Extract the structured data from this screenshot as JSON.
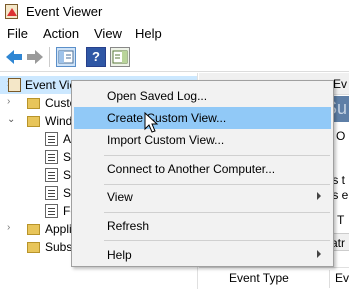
{
  "window": {
    "title": "Event Viewer"
  },
  "menu": [
    "File",
    "Action",
    "View",
    "Help"
  ],
  "toolbar": {
    "buttons": [
      "back-arrow-icon",
      "forward-arrow-icon",
      "show-hide-console-tree-icon",
      "help-icon",
      "show-hide-action-pane-icon"
    ],
    "help_glyph": "?"
  },
  "tree": {
    "items": [
      {
        "label": "Event Viewer (Local)",
        "shown": "Event Vie",
        "icon": "event-viewer-icon",
        "toggle": "›",
        "selected": true
      },
      {
        "label": "Custom Views",
        "shown": "Custo",
        "icon": "folder-icon",
        "toggle": "›"
      },
      {
        "label": "Windows Logs",
        "shown": "Wind",
        "icon": "folder-icon",
        "toggle": "⌄"
      },
      {
        "label": "Application",
        "shown": "A",
        "icon": "log-icon"
      },
      {
        "label": "Security",
        "shown": "Se",
        "icon": "log-icon"
      },
      {
        "label": "Setup",
        "shown": "Se",
        "icon": "log-icon"
      },
      {
        "label": "System",
        "shown": "Sy",
        "icon": "log-icon"
      },
      {
        "label": "Forwarded Events",
        "shown": "Fo",
        "icon": "log-icon"
      },
      {
        "label": "Applications and Services Logs",
        "shown": "Appli",
        "icon": "folder-icon",
        "toggle": "›"
      },
      {
        "label": "Subscriptions",
        "shown": "Subsc",
        "icon": "folder-icon"
      }
    ]
  },
  "right_panel": {
    "header_frag": "Ev",
    "banner_text": "Su",
    "frags": [
      "O",
      "ts t",
      "ts e",
      "T"
    ],
    "tab_frag": "atr",
    "column_header": "Event Type",
    "column_frag": "Ev"
  },
  "context_menu": {
    "items": [
      {
        "label": "Open Saved Log...",
        "submenu": false
      },
      {
        "label": "Create Custom View...",
        "submenu": false,
        "highlighted": true
      },
      {
        "label": "Import Custom View...",
        "submenu": false
      },
      {
        "label": "Connect to Another Computer...",
        "submenu": false
      },
      {
        "label": "View",
        "submenu": true
      },
      {
        "label": "Refresh",
        "submenu": false
      },
      {
        "label": "Help",
        "submenu": true
      }
    ]
  },
  "colors": {
    "highlight": "#91c9f7",
    "selection": "#cce8ff",
    "banner": "#5e7fa7"
  }
}
